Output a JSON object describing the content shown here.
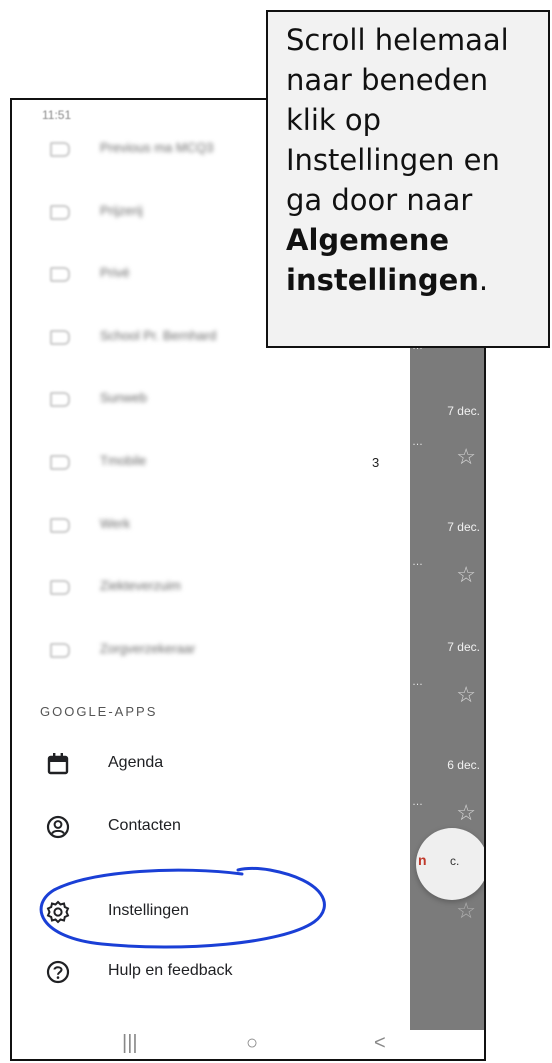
{
  "callout": {
    "line1": "Scroll helemaal",
    "line2": "naar beneden",
    "line3": "klik op",
    "line4": "Instellingen en",
    "line5": "ga door naar",
    "bold1": "Algemene",
    "bold2": "instellingen",
    "tail": "."
  },
  "status_bar": {
    "time": "11:51"
  },
  "labels": [
    {
      "name": "Previous ma MCQ3"
    },
    {
      "name": "Prijzerij"
    },
    {
      "name": "Privé"
    },
    {
      "name": "School Pr. Bernhard"
    },
    {
      "name": "Sunweb"
    },
    {
      "name": "Tmobile",
      "count": "3"
    },
    {
      "name": "Werk"
    },
    {
      "name": "Ziekteverzuim"
    },
    {
      "name": "Zorgverzekeraar"
    }
  ],
  "google_apps": {
    "title": "GOOGLE-APPS",
    "items": [
      {
        "label": "Agenda",
        "icon": "calendar-icon"
      },
      {
        "label": "Contacten",
        "icon": "contacts-icon"
      }
    ]
  },
  "settings_items": [
    {
      "label": "Instellingen",
      "icon": "gear-icon"
    },
    {
      "label": "Hulp en feedback",
      "icon": "help-icon"
    }
  ],
  "inbox": {
    "dates": [
      "7 dec.",
      "7 dec.",
      "7 dec.",
      "6 dec."
    ],
    "bubble_left": "n",
    "bubble_right": "c."
  },
  "nav_bar": {
    "recents": "|||",
    "home": "○",
    "back": "<"
  },
  "colors": {
    "annotation": "#1a3fd6",
    "overlay": "#7b7b7b"
  }
}
